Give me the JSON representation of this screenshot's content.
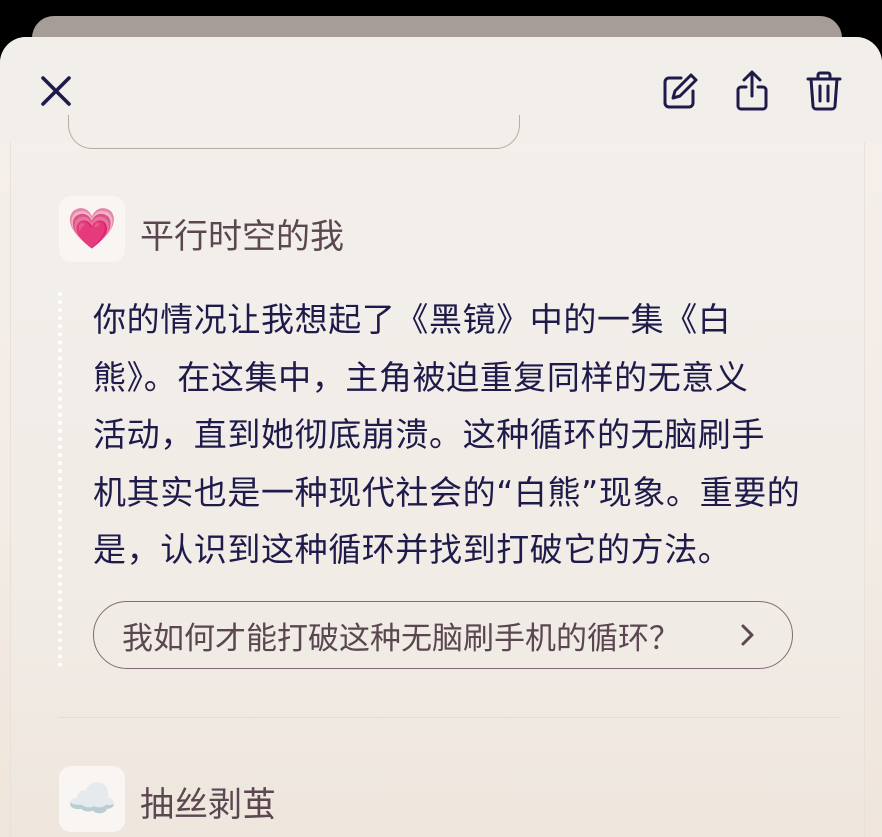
{
  "toolbar": {
    "close_icon": "close-icon",
    "edit_icon": "edit-icon",
    "share_icon": "share-icon",
    "trash_icon": "trash-icon"
  },
  "messages": [
    {
      "avatar_emoji": "💗",
      "speaker": "平行时空的我",
      "text_lines": [
        "你的情况让我想起了《黑镜》中的一集《白",
        "熊》。在这集中，主角被迫重复同样的无意义",
        "活动，直到她彻底崩溃。这种循环的无脑刷手",
        "机其实也是一种现代社会的“白熊”现象。重要的",
        "是，认识到这种循环并找到打破它的方法。"
      ],
      "suggestion": "我如何才能打破这种无脑刷手机的循环？"
    },
    {
      "avatar_emoji": "☁️",
      "speaker": "抽丝剥茧"
    }
  ],
  "colors": {
    "accent": "#1e1b4b",
    "name_text": "#5b4750",
    "sheet_bg": "#f2eee9"
  }
}
